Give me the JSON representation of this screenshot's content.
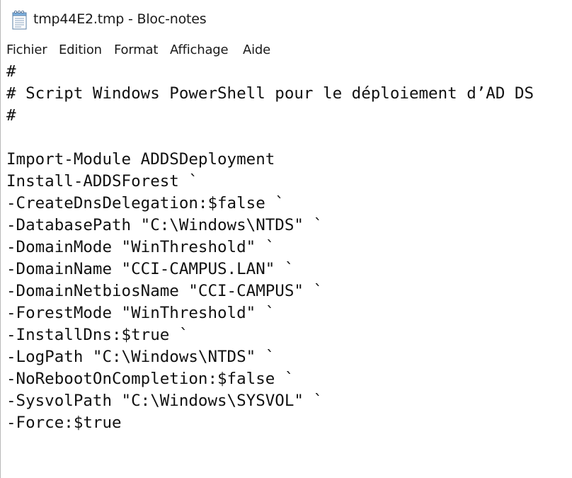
{
  "window": {
    "title": "tmp44E2.tmp - Bloc-notes",
    "icon": "notepad-icon"
  },
  "menu": {
    "items": [
      "Fichier",
      "Edition",
      "Format",
      "Affichage",
      "Aide"
    ]
  },
  "editor": {
    "lines": [
      "#",
      "# Script Windows PowerShell pour le déploiement d’AD DS",
      "#",
      "",
      "Import-Module ADDSDeployment",
      "Install-ADDSForest `",
      "-CreateDnsDelegation:$false `",
      "-DatabasePath \"C:\\Windows\\NTDS\" `",
      "-DomainMode \"WinThreshold\" `",
      "-DomainName \"CCI-CAMPUS.LAN\" `",
      "-DomainNetbiosName \"CCI-CAMPUS\" `",
      "-ForestMode \"WinThreshold\" `",
      "-InstallDns:$true `",
      "-LogPath \"C:\\Windows\\NTDS\" `",
      "-NoRebootOnCompletion:$false `",
      "-SysvolPath \"C:\\Windows\\SYSVOL\" `",
      "-Force:$true"
    ]
  }
}
